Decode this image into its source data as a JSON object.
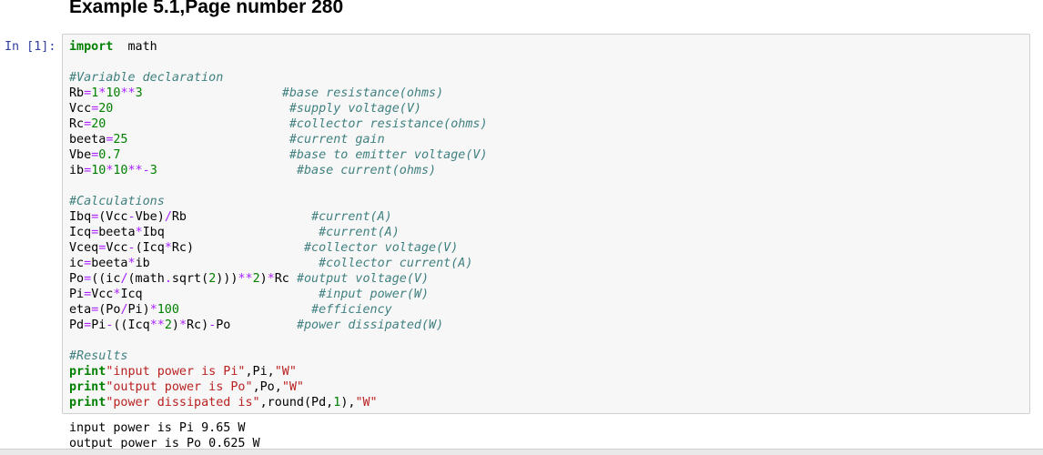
{
  "notebook": {
    "heading": "Example 5.1,Page number 280",
    "prompt": "In [1]:",
    "code_lines": [
      [
        [
          "kw",
          "import"
        ],
        [
          "",
          "  math"
        ]
      ],
      [],
      [
        [
          "cm",
          "#Variable declaration"
        ]
      ],
      [
        [
          "",
          "Rb"
        ],
        [
          "op",
          "="
        ],
        [
          "num",
          "1"
        ],
        [
          "op",
          "*"
        ],
        [
          "num",
          "10"
        ],
        [
          "op",
          "**"
        ],
        [
          "num",
          "3"
        ],
        [
          "",
          "                   "
        ],
        [
          "cm",
          "#base resistance(ohms)"
        ]
      ],
      [
        [
          "",
          "Vcc"
        ],
        [
          "op",
          "="
        ],
        [
          "num",
          "20"
        ],
        [
          "",
          "                        "
        ],
        [
          "cm",
          "#supply voltage(V)"
        ]
      ],
      [
        [
          "",
          "Rc"
        ],
        [
          "op",
          "="
        ],
        [
          "num",
          "20"
        ],
        [
          "",
          "                         "
        ],
        [
          "cm",
          "#collector resistance(ohms)"
        ]
      ],
      [
        [
          "",
          "beeta"
        ],
        [
          "op",
          "="
        ],
        [
          "num",
          "25"
        ],
        [
          "",
          "                      "
        ],
        [
          "cm",
          "#current gain"
        ]
      ],
      [
        [
          "",
          "Vbe"
        ],
        [
          "op",
          "="
        ],
        [
          "num",
          "0.7"
        ],
        [
          "",
          "                       "
        ],
        [
          "cm",
          "#base to emitter voltage(V)"
        ]
      ],
      [
        [
          "",
          "ib"
        ],
        [
          "op",
          "="
        ],
        [
          "num",
          "10"
        ],
        [
          "op",
          "*"
        ],
        [
          "num",
          "10"
        ],
        [
          "op",
          "**-"
        ],
        [
          "num",
          "3"
        ],
        [
          "",
          "                   "
        ],
        [
          "cm",
          "#base current(ohms)"
        ]
      ],
      [],
      [
        [
          "cm",
          "#Calculations"
        ]
      ],
      [
        [
          "",
          "Ibq"
        ],
        [
          "op",
          "="
        ],
        [
          "",
          "(Vcc"
        ],
        [
          "op",
          "-"
        ],
        [
          "",
          "Vbe)"
        ],
        [
          "op",
          "/"
        ],
        [
          "",
          "Rb"
        ],
        [
          "",
          "                 "
        ],
        [
          "cm",
          "#current(A)"
        ]
      ],
      [
        [
          "",
          "Icq"
        ],
        [
          "op",
          "="
        ],
        [
          "",
          "beeta"
        ],
        [
          "op",
          "*"
        ],
        [
          "",
          "Ibq"
        ],
        [
          "",
          "                     "
        ],
        [
          "cm",
          "#current(A)"
        ]
      ],
      [
        [
          "",
          "Vceq"
        ],
        [
          "op",
          "="
        ],
        [
          "",
          "Vcc"
        ],
        [
          "op",
          "-"
        ],
        [
          "",
          "(Icq"
        ],
        [
          "op",
          "*"
        ],
        [
          "",
          "Rc)"
        ],
        [
          "",
          "               "
        ],
        [
          "cm",
          "#collector voltage(V)"
        ]
      ],
      [
        [
          "",
          "ic"
        ],
        [
          "op",
          "="
        ],
        [
          "",
          "beeta"
        ],
        [
          "op",
          "*"
        ],
        [
          "",
          "ib"
        ],
        [
          "",
          "                       "
        ],
        [
          "cm",
          "#collector current(A)"
        ]
      ],
      [
        [
          "",
          "Po"
        ],
        [
          "op",
          "="
        ],
        [
          "",
          "((ic"
        ],
        [
          "op",
          "/"
        ],
        [
          "",
          "(math"
        ],
        [
          "op",
          "."
        ],
        [
          "",
          "sqrt("
        ],
        [
          "num",
          "2"
        ],
        [
          "",
          ")))"
        ],
        [
          "op",
          "**"
        ],
        [
          "num",
          "2"
        ],
        [
          "",
          ")"
        ],
        [
          "op",
          "*"
        ],
        [
          "",
          "Rc "
        ],
        [
          "cm",
          "#output voltage(V)"
        ]
      ],
      [
        [
          "",
          "Pi"
        ],
        [
          "op",
          "="
        ],
        [
          "",
          "Vcc"
        ],
        [
          "op",
          "*"
        ],
        [
          "",
          "Icq"
        ],
        [
          "",
          "                        "
        ],
        [
          "cm",
          "#input power(W)"
        ]
      ],
      [
        [
          "",
          "eta"
        ],
        [
          "op",
          "="
        ],
        [
          "",
          "(Po"
        ],
        [
          "op",
          "/"
        ],
        [
          "",
          "Pi)"
        ],
        [
          "op",
          "*"
        ],
        [
          "num",
          "100"
        ],
        [
          "",
          "                  "
        ],
        [
          "cm",
          "#efficiency"
        ]
      ],
      [
        [
          "",
          "Pd"
        ],
        [
          "op",
          "="
        ],
        [
          "",
          "Pi"
        ],
        [
          "op",
          "-"
        ],
        [
          "",
          "((Icq"
        ],
        [
          "op",
          "**"
        ],
        [
          "num",
          "2"
        ],
        [
          "",
          ")"
        ],
        [
          "op",
          "*"
        ],
        [
          "",
          "Rc)"
        ],
        [
          "op",
          "-"
        ],
        [
          "",
          "Po"
        ],
        [
          "",
          "         "
        ],
        [
          "cm",
          "#power dissipated(W)"
        ]
      ],
      [],
      [
        [
          "cm",
          "#Results"
        ]
      ],
      [
        [
          "kw",
          "print"
        ],
        [
          "str",
          "\"input power is Pi\""
        ],
        [
          "",
          ",Pi,"
        ],
        [
          "str",
          "\"W\""
        ]
      ],
      [
        [
          "kw",
          "print"
        ],
        [
          "str",
          "\"output power is Po\""
        ],
        [
          "",
          ",Po,"
        ],
        [
          "str",
          "\"W\""
        ]
      ],
      [
        [
          "kw",
          "print"
        ],
        [
          "str",
          "\"power dissipated is\""
        ],
        [
          "",
          ",round(Pd,"
        ],
        [
          "num",
          "1"
        ],
        [
          "",
          "),"
        ],
        [
          "str",
          "\"W\""
        ]
      ]
    ],
    "output_lines": [
      "input power is Pi 9.65 W",
      "output power is Po 0.625 W"
    ]
  },
  "colors": {
    "keyword": "#008000",
    "comment": "#408080",
    "number": "#008000",
    "operator": "#aa22ff",
    "string": "#ba2121",
    "prompt": "#303f9f",
    "cell_background": "#f7f7f7",
    "cell_border": "#cfcfcf"
  }
}
